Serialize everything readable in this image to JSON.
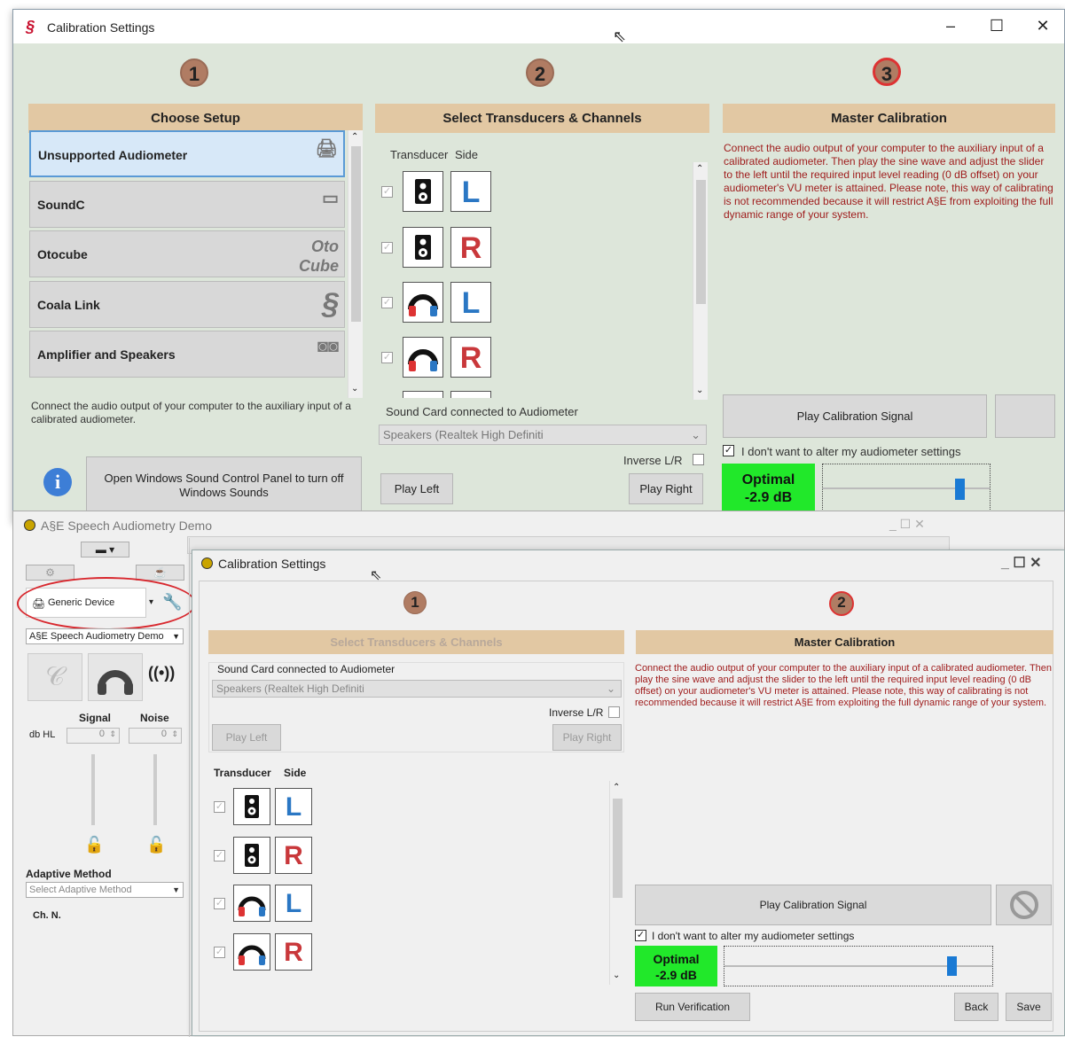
{
  "win1": {
    "title": "Calibration Settings",
    "steps": [
      "1",
      "2",
      "3"
    ],
    "headers": {
      "setup": "Choose Setup",
      "transducers": "Select Transducers & Channels",
      "master": "Master Calibration"
    },
    "devices": [
      {
        "label": "Unsupported Audiometer",
        "icon": "audiometer-icon",
        "selected": true
      },
      {
        "label": "SoundC",
        "icon": "soundcard-icon",
        "selected": false
      },
      {
        "label": "Otocube",
        "icon": "otocube-logo",
        "selected": false
      },
      {
        "label": "Coala Link",
        "icon": "coala-logo",
        "selected": false
      },
      {
        "label": "Amplifier and Speakers",
        "icon": "speakers-icon",
        "selected": false
      }
    ],
    "otocube_logo_text": "Oto\nCube",
    "setup_note": "Connect the audio output of your computer to the auxiliary input of a calibrated audiometer.",
    "sound_panel_btn": "Open Windows Sound Control Panel to turn off Windows Sounds",
    "col_transducer": "Transducer",
    "col_side": "Side",
    "rows": [
      {
        "t": "speaker",
        "s": "L"
      },
      {
        "t": "speaker",
        "s": "R"
      },
      {
        "t": "headphones",
        "s": "L"
      },
      {
        "t": "headphones",
        "s": "R"
      }
    ],
    "soundcard_label": "Sound Card connected to Audiometer",
    "soundcard_value": "Speakers (Realtek High Definiti",
    "inverse": "Inverse L/R",
    "play_left": "Play Left",
    "play_right": "Play Right",
    "master_note": "Connect the audio output of your computer to the auxiliary input of a calibrated audiometer. Then play the sine wave and adjust the slider to the left until the required input level reading (0 dB offset) on your audiometer's VU meter is attained. Please note, this way of calibrating is not recommended because it will restrict A§E from exploiting the full dynamic range of your system.",
    "play_cal": "Play Calibration Signal",
    "dont_alter": "I don't want to alter my audiometer settings",
    "optimal": "Optimal",
    "optimal_db": "-2.9 dB"
  },
  "app": {
    "title": "A§E Speech Audiometry Demo",
    "device": "Generic Device",
    "profile": "A§E Speech Audiometry Demo",
    "signal": "Signal",
    "noise": "Noise",
    "dbhl": "db HL",
    "signal_val": "0",
    "noise_val": "0",
    "adaptive": "Adaptive Method",
    "adaptive_placeholder": "Select Adaptive Method",
    "chn": "Ch. N."
  },
  "win3": {
    "title": "Calibration Settings",
    "steps": [
      "1",
      "2"
    ],
    "headers": {
      "transducers": "Select Transducers & Channels",
      "master": "Master Calibration"
    },
    "soundcard_label": "Sound Card connected to Audiometer",
    "soundcard_value": "Speakers (Realtek High Definiti",
    "inverse": "Inverse L/R",
    "play_left": "Play Left",
    "play_right": "Play Right",
    "col_transducer": "Transducer",
    "col_side": "Side",
    "master_note": "Connect the audio output of your computer to the auxiliary input of a calibrated audiometer. Then play the sine wave and adjust the slider to the left until the required input level reading (0 dB offset) on your audiometer's VU meter is attained. Please note, this way of calibrating is not recommended because it will restrict A§E from exploiting the full dynamic range of your system.",
    "play_cal": "Play Calibration Signal",
    "dont_alter": "I don't want to alter my audiometer settings",
    "optimal": "Optimal",
    "optimal_db": "-2.9 dB",
    "run_verification": "Run Verification",
    "back": "Back",
    "save": "Save"
  }
}
